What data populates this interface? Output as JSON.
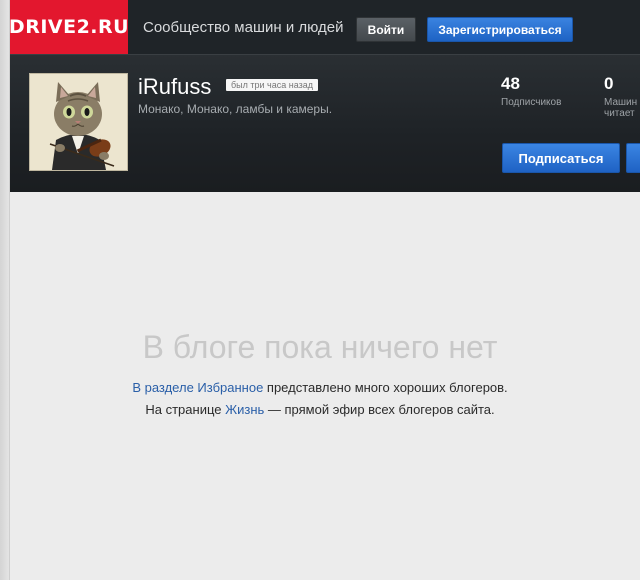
{
  "header": {
    "logo": "DRIVE2.RU",
    "tagline": "Сообщество машин и людей",
    "login_label": "Войти",
    "register_label": "Зарегистрироваться"
  },
  "profile": {
    "username": "iRufuss",
    "last_seen": "был три часа назад",
    "bio": "Монако, Монако, ламбы и камеры.",
    "stats": [
      {
        "value": "48",
        "label": "Подписчиков"
      },
      {
        "value": "0",
        "label_line1": "Машин",
        "label_line2": "читает"
      }
    ],
    "subscribe_label": "Подписаться"
  },
  "empty_state": {
    "title": "В блоге пока ничего нет",
    "line1_link": "В разделе Избранное",
    "line1_text": " представлено много хороших блогеров.",
    "line2_prefix": "На странице ",
    "line2_link": "Жизнь",
    "line2_text": " — прямой эфир всех блогеров сайта."
  },
  "colors": {
    "brand_red": "#e3172e",
    "button_blue": "#1f62c4",
    "topbar_bg": "#1f2428",
    "link_blue": "#2a5fa8"
  }
}
